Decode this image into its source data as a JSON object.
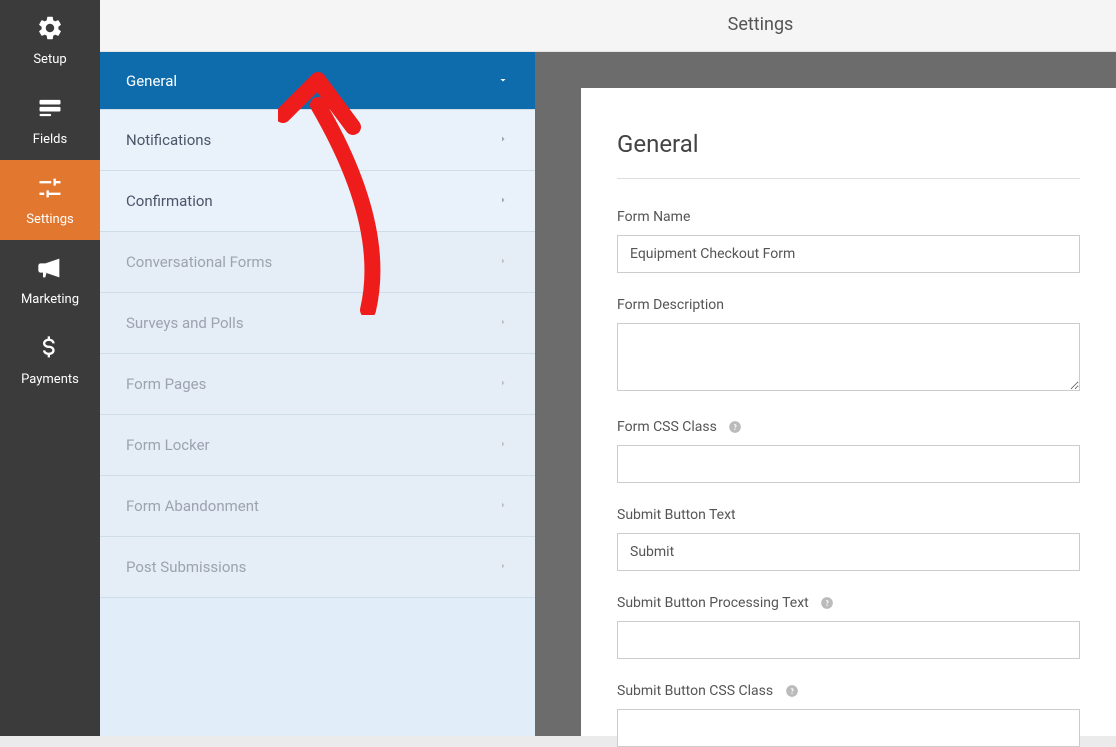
{
  "header": {
    "title": "Settings"
  },
  "iconSidebar": {
    "items": [
      {
        "label": "Setup",
        "icon": "gear"
      },
      {
        "label": "Fields",
        "icon": "fields"
      },
      {
        "label": "Settings",
        "icon": "sliders",
        "active": true
      },
      {
        "label": "Marketing",
        "icon": "bullhorn"
      },
      {
        "label": "Payments",
        "icon": "dollar"
      }
    ]
  },
  "settingsMenu": {
    "items": [
      {
        "label": "General",
        "active": true
      },
      {
        "label": "Notifications"
      },
      {
        "label": "Confirmation"
      },
      {
        "label": "Conversational Forms",
        "muted": true
      },
      {
        "label": "Surveys and Polls",
        "muted": true
      },
      {
        "label": "Form Pages",
        "muted": true
      },
      {
        "label": "Form Locker",
        "muted": true
      },
      {
        "label": "Form Abandonment",
        "muted": true
      },
      {
        "label": "Post Submissions",
        "muted": true
      }
    ]
  },
  "content": {
    "heading": "General",
    "formName": {
      "label": "Form Name",
      "value": "Equipment Checkout Form"
    },
    "formDescription": {
      "label": "Form Description",
      "value": ""
    },
    "formCssClass": {
      "label": "Form CSS Class",
      "value": ""
    },
    "submitButtonText": {
      "label": "Submit Button Text",
      "value": "Submit"
    },
    "submitButtonProcessingText": {
      "label": "Submit Button Processing Text",
      "value": ""
    },
    "submitButtonCssClass": {
      "label": "Submit Button CSS Class",
      "value": ""
    }
  }
}
